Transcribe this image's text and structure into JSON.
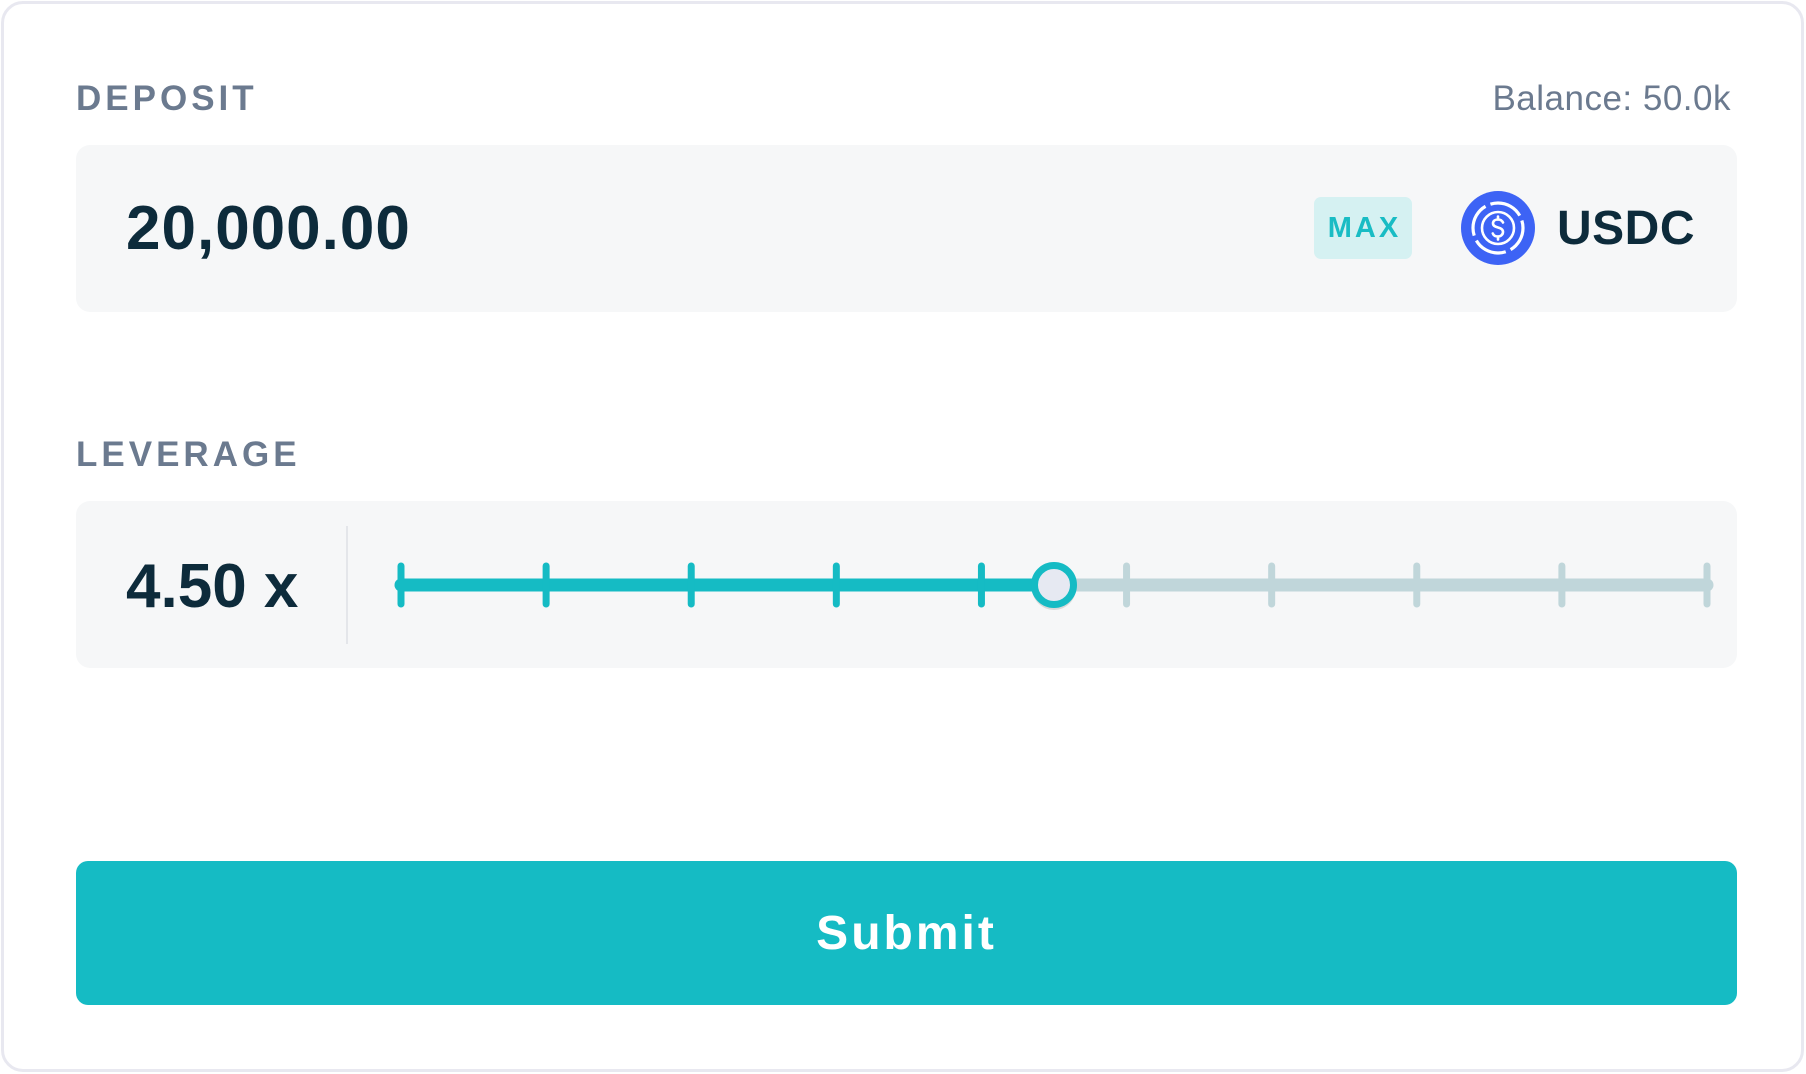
{
  "deposit": {
    "label": "DEPOSIT",
    "balance": "Balance: 50.0k",
    "amount": "20,000.00",
    "max_label": "MAX",
    "token": {
      "name": "USDC",
      "icon": "usdc-icon",
      "color": "#3d63f5"
    }
  },
  "leverage": {
    "label": "LEVERAGE",
    "value": "4.50 x",
    "slider": {
      "tick_count": 10,
      "fill_fraction": 0.5,
      "active_color": "#15bbc4",
      "inactive_color": "#c0d6da"
    }
  },
  "submit": {
    "label": "Submit",
    "color": "#15bbc4"
  }
}
